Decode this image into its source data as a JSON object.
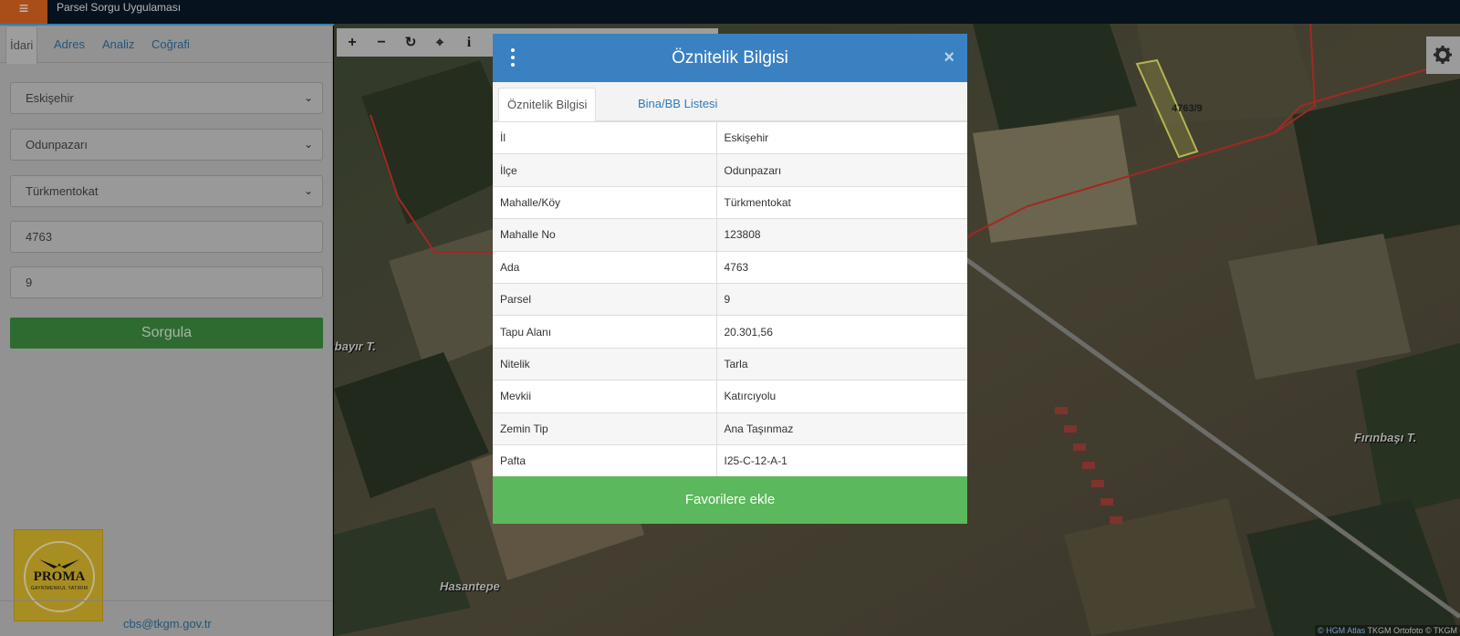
{
  "app": {
    "title": "Parsel Sorgu Uygulaması",
    "menu_icon": "hamburger-icon"
  },
  "sidebar": {
    "tabs": [
      {
        "label": "İdari",
        "active": true
      },
      {
        "label": "Adres",
        "active": false
      },
      {
        "label": "Analiz",
        "active": false
      },
      {
        "label": "Coğrafi",
        "active": false
      }
    ],
    "fields": {
      "il": "Eskişehir",
      "ilce": "Odunpazarı",
      "mahalle": "Türkmentokat",
      "ada": "4763",
      "parsel": "9"
    },
    "query_button": "Sorgula",
    "email": "cbs@tkgm.gov.tr",
    "logo": {
      "brand": "PROMA",
      "subtitle": "GAYRİMENKUL YATIRIM"
    }
  },
  "map": {
    "labels": {
      "place1": "rıbayır T.",
      "place2": "Fırınbaşı T.",
      "place3": "Hasantepe",
      "parcel": "4763/9"
    },
    "attribution": {
      "hgm": "© HGM Atlas",
      "tkgm": "TKGM Ortofoto © TKGM"
    },
    "colors": {
      "boundary": "#d0342c",
      "parcel": "#e8e86a"
    }
  },
  "modal": {
    "title": "Öznitelik Bilgisi",
    "tabs": [
      "Öznitelik Bilgisi",
      "Bina/BB Listesi"
    ],
    "rows": [
      {
        "key": "İl",
        "value": "Eskişehir"
      },
      {
        "key": "İlçe",
        "value": "Odunpazarı"
      },
      {
        "key": "Mahalle/Köy",
        "value": "Türkmentokat"
      },
      {
        "key": "Mahalle No",
        "value": "123808"
      },
      {
        "key": "Ada",
        "value": "4763"
      },
      {
        "key": "Parsel",
        "value": "9"
      },
      {
        "key": "Tapu Alanı",
        "value": "20.301,56"
      },
      {
        "key": "Nitelik",
        "value": "Tarla"
      },
      {
        "key": "Mevkii",
        "value": "Katırcıyolu"
      },
      {
        "key": "Zemin Tip",
        "value": "Ana Taşınmaz"
      },
      {
        "key": "Pafta",
        "value": "I25-C-12-A-1"
      }
    ],
    "favorite_button": "Favorilere ekle"
  }
}
